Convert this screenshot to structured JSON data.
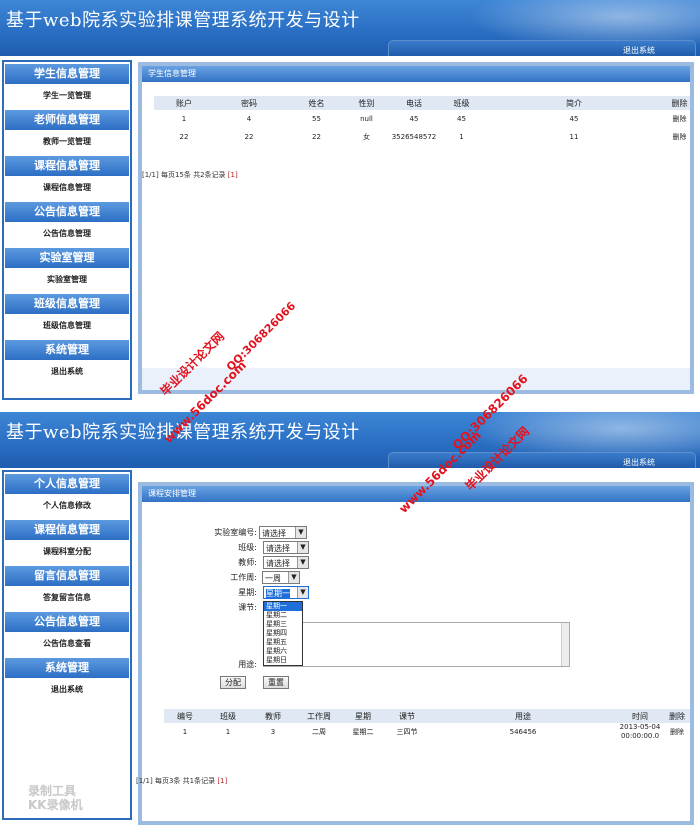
{
  "banner": {
    "title": "基于web院系实验排课管理系统开发与设计",
    "logout_label": "退出系统"
  },
  "panel1": {
    "sidebar": [
      {
        "head": "学生信息管理",
        "item": "学生一览管理"
      },
      {
        "head": "老师信息管理",
        "item": "教师一览管理"
      },
      {
        "head": "课程信息管理",
        "item": "课程信息管理"
      },
      {
        "head": "公告信息管理",
        "item": "公告信息管理"
      },
      {
        "head": "实验室管理",
        "item": "实验室管理"
      },
      {
        "head": "班级信息管理",
        "item": "班级信息管理"
      },
      {
        "head": "系统管理",
        "item": "退出系统"
      }
    ],
    "main_title": "学生信息管理",
    "table": {
      "headers": [
        "账户",
        "密码",
        "姓名",
        "性别",
        "电话",
        "班级",
        "简介",
        "删除"
      ],
      "rows": [
        [
          "1",
          "4",
          "55",
          "null",
          "45",
          "45",
          "45",
          "删除"
        ],
        [
          "22",
          "22",
          "22",
          "女",
          "3526548572",
          "1",
          "11",
          "删除"
        ]
      ]
    },
    "pager": {
      "text": "[1/1] 每页15条 共2条记录",
      "link": "[1]"
    }
  },
  "panel2": {
    "sidebar": [
      {
        "head": "个人信息管理",
        "item": "个人信息修改"
      },
      {
        "head": "课程信息管理",
        "item": "课程科室分配"
      },
      {
        "head": "留言信息管理",
        "item": "答复留言信息"
      },
      {
        "head": "公告信息管理",
        "item": "公告信息查看"
      },
      {
        "head": "系统管理",
        "item": "退出系统"
      }
    ],
    "main_title": "课程安排管理",
    "form": {
      "lab_label": "实验室编号:",
      "lab_value": "请选择",
      "class_label": "班级:",
      "class_value": "请选择",
      "teacher_label": "教师:",
      "teacher_value": "请选择",
      "week_label": "工作周:",
      "week_value": "一周",
      "day_label": "星期:",
      "day_value": "星期一",
      "section_label": "课节:",
      "purpose_label": "用途:",
      "submit_label": "分配",
      "reset_label": "重置"
    },
    "day_options": [
      "星期一",
      "星期二",
      "星期三",
      "星期四",
      "星期五",
      "星期六",
      "星期日"
    ],
    "table": {
      "headers": [
        "编号",
        "班级",
        "教师",
        "工作周",
        "星期",
        "课节",
        "用途",
        "时间",
        "删除"
      ],
      "rows": [
        [
          "1",
          "1",
          "3",
          "二周",
          "星期二",
          "三四节",
          "546456",
          "2013-05-04 00:00:00.0",
          "删除"
        ]
      ]
    },
    "pager": {
      "text": "[1/1] 每页3条 共1条记录",
      "link": "[1]"
    }
  },
  "watermarks": {
    "site": "www.56doc.com",
    "name": "毕业设计论文网",
    "qq": "QQ:306826066",
    "recorder_line1": "录制工具",
    "recorder_line2": "KK录像机"
  }
}
